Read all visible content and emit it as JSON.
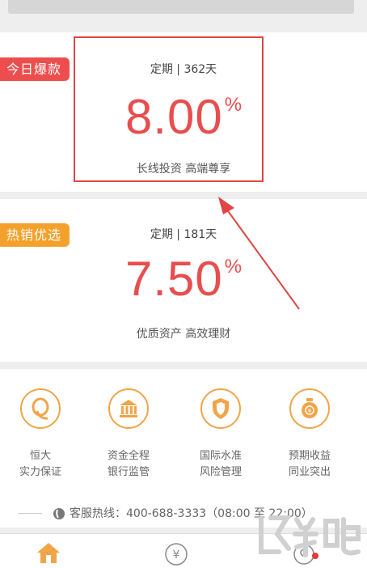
{
  "products": [
    {
      "badge": "今日爆款",
      "period": "定期 | 362天",
      "rate": "8.00",
      "rate_unit": "%",
      "description": "长线投资 高端尊享"
    },
    {
      "badge": "热销优选",
      "period": "定期 | 181天",
      "rate": "7.50",
      "rate_unit": "%",
      "description": "优质资产 高效理财"
    }
  ],
  "features": [
    {
      "line1": "恒大",
      "line2": "实力保证",
      "icon": "q-logo-icon"
    },
    {
      "line1": "资金全程",
      "line2": "银行监管",
      "icon": "bank-icon"
    },
    {
      "line1": "国际水准",
      "line2": "风险管理",
      "icon": "shield-icon"
    },
    {
      "line1": "预期收益",
      "line2": "同业突出",
      "icon": "moneybag-icon"
    }
  ],
  "hotline": {
    "text": "客服热线：400-688-3333（08:00 至 22:00）",
    "icon": "phone-icon"
  },
  "tabbar": {
    "tabs": [
      "home-icon",
      "yen-icon",
      "profile-icon"
    ],
    "notification_dot": true
  },
  "watermark": "下载吧",
  "colors": {
    "accent_red": "#e84e4e",
    "badge_red": "#ee4d4d",
    "badge_orange": "#f4a12b",
    "icon_orange": "#f0a548"
  }
}
